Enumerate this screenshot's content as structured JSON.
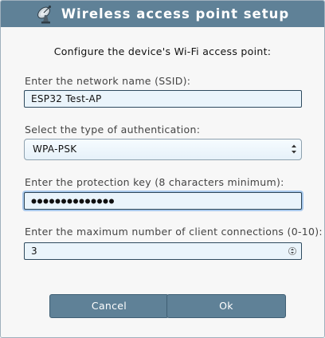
{
  "dialog": {
    "title": "Wireless access point setup",
    "heading": "Configure the device's Wi-Fi access point:",
    "title_icon": "satellite-dish-icon"
  },
  "ssid": {
    "label": "Enter the network name (SSID):",
    "value": "ESP32 Test-AP"
  },
  "auth": {
    "label": "Select the type of authentication:",
    "selected": "WPA-PSK"
  },
  "key": {
    "label": "Enter the protection key (8 characters minimum):",
    "masked_length": 14
  },
  "max_clients": {
    "label": "Enter the maximum number of client connections (0-10):",
    "value": "3"
  },
  "buttons": {
    "cancel": "Cancel",
    "ok": "Ok"
  },
  "colors": {
    "titlebar": "#5f8197",
    "field_bg": "#eaf4fb",
    "focus_ring": "#a9c9ec"
  }
}
